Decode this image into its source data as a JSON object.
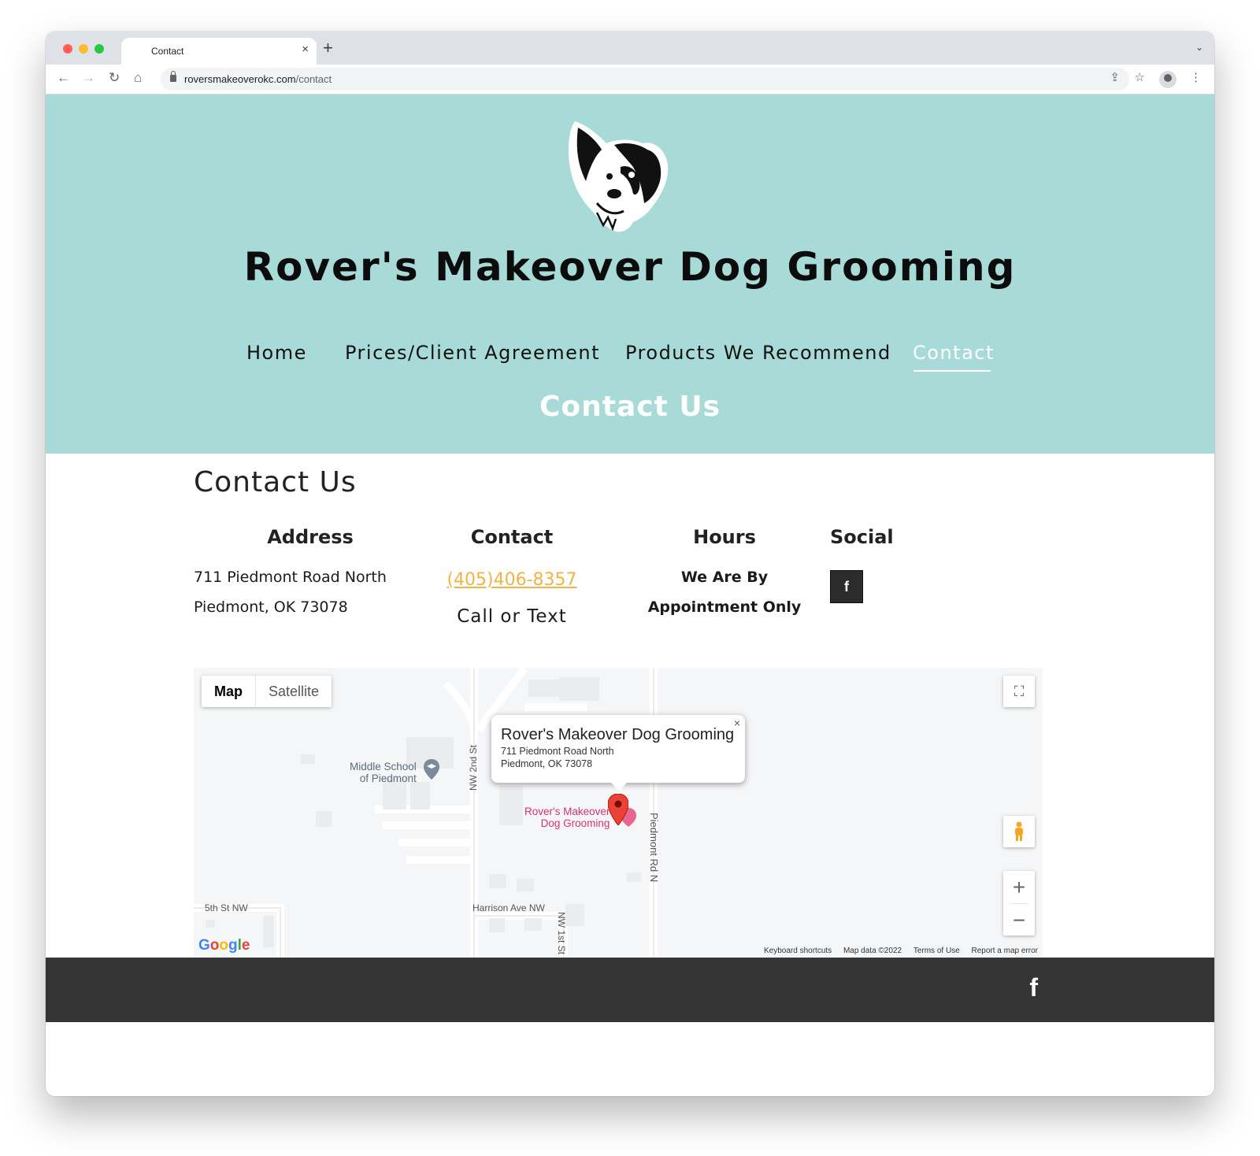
{
  "browser": {
    "tab_title": "Contact",
    "tab_close": "×",
    "new_tab": "+",
    "url_domain": "roversmakeoverokc.com",
    "url_path": "/contact"
  },
  "site": {
    "title": "Rover's Makeover Dog Grooming",
    "nav": [
      "Home",
      "Prices/Client Agreement",
      "Products We Recommend",
      "Contact"
    ],
    "hero_heading": "Contact Us"
  },
  "contact": {
    "title": "Contact Us",
    "address_head": "Address",
    "address_line1": "711 Piedmont Road North",
    "address_line2": "Piedmont, OK 73078",
    "contact_head": "Contact",
    "phone": "(405)406-8357",
    "call_text": "Call or Text",
    "hours_head": "Hours",
    "hours_line1": "We Are By",
    "hours_line2": "Appointment Only",
    "social_head": "Social",
    "facebook_glyph": "f"
  },
  "map": {
    "type_map": "Map",
    "type_satellite": "Satellite",
    "info_title": "Rover's Makeover Dog Grooming",
    "info_line1": "711 Piedmont Road North",
    "info_line2": "Piedmont, OK 73078",
    "info_close": "×",
    "poi_line1": "Rover's Makeover",
    "poi_line2": "Dog Grooming",
    "school_line1": "Middle School",
    "school_line2": "of Piedmont",
    "street_nw2": "NW 2nd St",
    "street_nw1": "NW 1st St",
    "street_piedmont": "Piedmont Rd N",
    "street_5th": "5th St NW",
    "street_harrison": "Harrison Ave NW",
    "zoom_in": "+",
    "zoom_out": "−",
    "google": "Google",
    "attrib_keyboard": "Keyboard shortcuts",
    "attrib_data": "Map data ©2022",
    "attrib_terms": "Terms of Use",
    "attrib_report": "Report a map error"
  },
  "footer": {
    "facebook_glyph": "f"
  }
}
